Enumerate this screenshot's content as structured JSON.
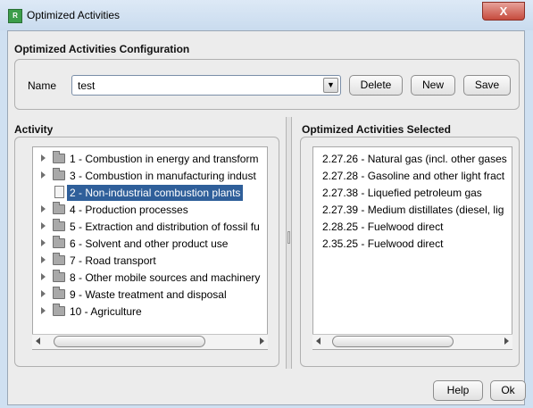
{
  "window": {
    "title": "Optimized Activities",
    "icon_text": "R",
    "close_label": "X"
  },
  "config": {
    "title": "Optimized Activities Configuration",
    "name_label": "Name",
    "name_value": "test",
    "delete_label": "Delete",
    "new_label": "New",
    "save_label": "Save"
  },
  "activity": {
    "title": "Activity",
    "items": [
      {
        "label": "1 - Combustion in energy and transform",
        "type": "folder"
      },
      {
        "label": "3 - Combustion in manufacturing indust",
        "type": "folder"
      },
      {
        "label": "2 - Non-industrial combustion plants",
        "type": "document",
        "selected": true
      },
      {
        "label": "4 - Production processes",
        "type": "folder"
      },
      {
        "label": "5 - Extraction and distribution of fossil fu",
        "type": "folder"
      },
      {
        "label": "6 - Solvent and other product use",
        "type": "folder"
      },
      {
        "label": "7 - Road transport",
        "type": "folder"
      },
      {
        "label": "8 - Other mobile sources and machinery",
        "type": "folder"
      },
      {
        "label": "9 - Waste treatment and disposal",
        "type": "folder"
      },
      {
        "label": "10 - Agriculture",
        "type": "folder"
      }
    ]
  },
  "selected_panel": {
    "title": "Optimized Activities Selected",
    "items": [
      "2.27.26 - Natural gas (incl. other gases",
      "2.27.28 - Gasoline and other light fract",
      "2.27.38 - Liquefied petroleum gas",
      "2.27.39 - Medium distillates (diesel, lig",
      "2.28.25 - Fuelwood direct",
      "2.35.25 - Fuelwood direct"
    ]
  },
  "footer": {
    "help_label": "Help",
    "ok_label": "Ok"
  },
  "colors": {
    "selection": "#2f5f9a",
    "close_button": "#c64b3d"
  }
}
